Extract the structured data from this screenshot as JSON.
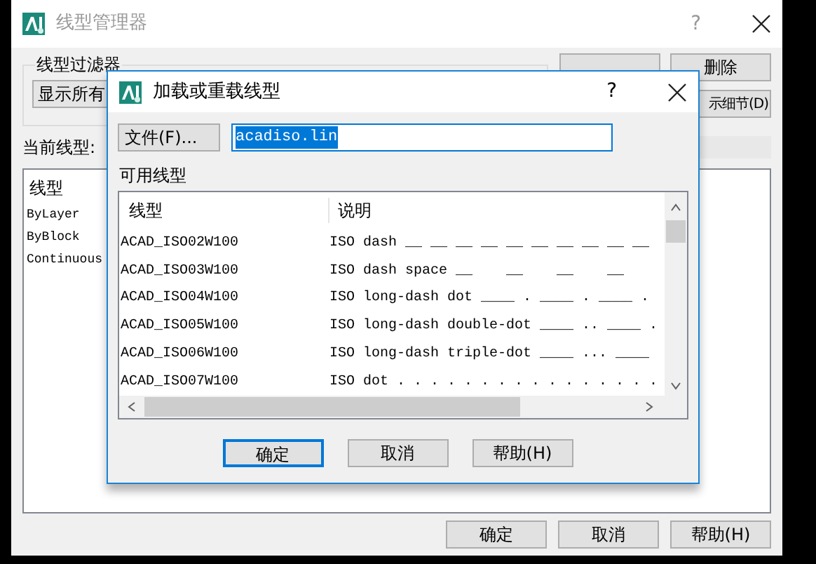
{
  "main_window": {
    "title": "线型管理器",
    "help": "?",
    "filter_label": "线型过滤器",
    "filter_value": "显示所有",
    "delete_button": "删除",
    "details_button": "示细节(D)",
    "current_label": "当前线型:",
    "list_header": "线型",
    "rows": [
      "ByLayer",
      "ByBlock",
      "Continuous"
    ],
    "buttons": [
      {
        "label": "确定"
      },
      {
        "label": "取消"
      },
      {
        "label": "帮助(H)"
      }
    ]
  },
  "dialog": {
    "title": "加载或重载线型",
    "help": "?",
    "file_button": "文件(F)...",
    "file_value": "acadiso.lin",
    "file_selected": true,
    "list_label": "可用线型",
    "columns": [
      "线型",
      "说明"
    ],
    "rows": [
      {
        "name": "ACAD_ISO02W100",
        "description": "ISO dash __ __ __ __ __ __ __ __ __ __"
      },
      {
        "name": "ACAD_ISO03W100",
        "description": "ISO dash space __    __    __    __"
      },
      {
        "name": "ACAD_ISO04W100",
        "description": "ISO long-dash dot ____ . ____ . ____ ."
      },
      {
        "name": "ACAD_ISO05W100",
        "description": "ISO long-dash double-dot ____ .. ____ ."
      },
      {
        "name": "ACAD_ISO06W100",
        "description": "ISO long-dash triple-dot ____ ... ____"
      },
      {
        "name": "ACAD_ISO07W100",
        "description": "ISO dot . . . . . . . . . . . . . . . ."
      }
    ],
    "buttons": [
      {
        "label": "确定",
        "selected": true
      },
      {
        "label": "取消",
        "selected": false
      },
      {
        "label": "帮助(H)",
        "selected": false
      }
    ]
  }
}
